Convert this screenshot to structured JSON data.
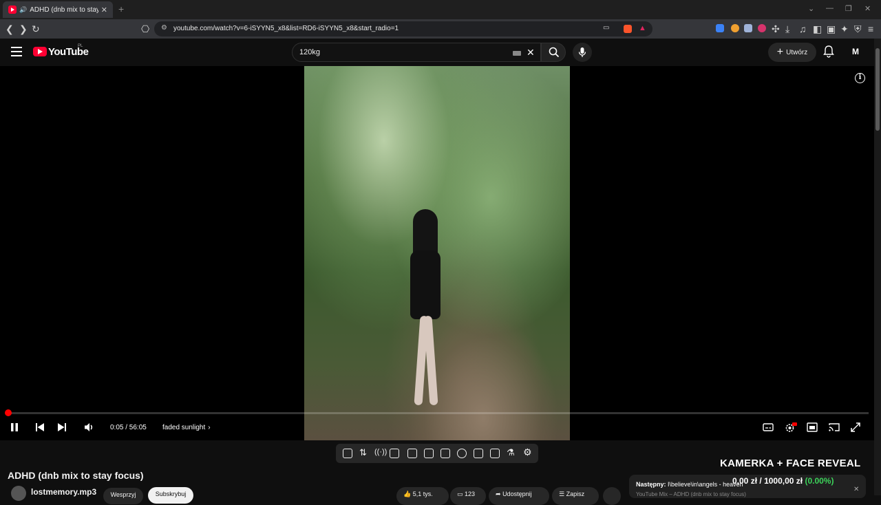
{
  "browser": {
    "tab_title": "ADHD (dnb mix to stay focus",
    "tab_close": "✕",
    "new_tab": "+",
    "url": "youtube.com/watch?v=6-iSYYN5_x8&list=RD6-iSYYN5_x8&start_radio=1"
  },
  "youtube": {
    "logo_text": "YouTube",
    "country_code": "PL",
    "search_value": "120kg",
    "create_label": "Utwórz",
    "avatar_letter": "M"
  },
  "player": {
    "time": "0:05 / 56:05",
    "chapter": "faded sunlight",
    "progress_fraction": 0.0015,
    "colors": {
      "accent": "#ff0000",
      "brand": "#ff0033"
    }
  },
  "video": {
    "title": "ADHD (dnb mix to stay focus)",
    "channel": "lostmemory.mp3",
    "join_label": "Wesprzyj",
    "subscribe_label": "Subskrybuj",
    "likes": "5,1 tys.",
    "saves": "123",
    "share_label": "Udostępnij",
    "save_label": "Zapisz"
  },
  "overlay": {
    "stream_title": "KAMERKA + FACE REVEAL",
    "next_prefix": "Następny:",
    "next_track": "I\\believe\\in\\angels - heaven",
    "next_sub": "YouTube Mix – ADHD (dnb mix to stay focus)",
    "money_current": "0,00 zł",
    "money_sep": "/",
    "money_goal": "1000,00 zł",
    "money_pct": "(0.00%)"
  }
}
